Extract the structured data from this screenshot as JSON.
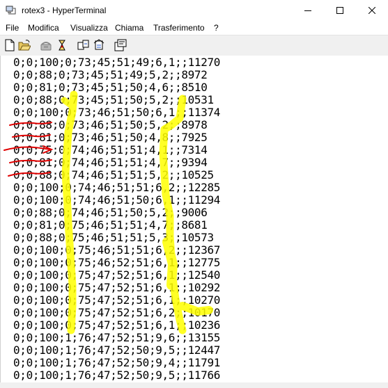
{
  "window": {
    "title": "rotex3 - HyperTerminal",
    "icons": [
      "hyperterminal-app-icon",
      "minimize-icon",
      "maximize-icon",
      "close-icon"
    ]
  },
  "menu": {
    "items": [
      "File",
      "Modifica",
      "Visualizza",
      "Chiama",
      "Trasferimento",
      "?"
    ]
  },
  "toolbar": {
    "icons": [
      "new-document-icon",
      "open-folder-icon",
      "call-icon",
      "disconnect-icon",
      "send-file-icon",
      "receive-file-icon",
      "properties-icon"
    ]
  },
  "terminal": {
    "lines": [
      "0;0;100;0;73;45;51;49;6,1;;11270",
      "0;0;88;0;73;45;51;49;5,2;;8972",
      "0;0;81;0;73;45;51;50;4,6;;8510",
      "0;0;88;0;73;45;51;50;5,2;;10531",
      "0;0;100;0;73;46;51;50;6,1;;11374",
      "0;0;88;0;73;46;51;50;5,2;;8978",
      "0;0;81;0;73;46;51;50;4,8;;7925",
      "0;0;75;0;74;46;51;51;4,1;;7314",
      "0;0;81;0;74;46;51;51;4,7;;9394",
      "0;0;88;0;74;46;51;51;5,2;;10525",
      "0;0;100;0;74;46;51;51;6,2;;12285",
      "0;0;100;0;74;46;51;50;6,1;;11294",
      "0;0;88;0;74;46;51;50;5,2;;9006",
      "0;0;81;0;75;46;51;51;4,7;;8681",
      "0;0;88;0;75;46;51;51;5,3;;10573",
      "0;0;100;0;75;46;51;51;6,2;;12367",
      "0;0;100;0;75;46;52;51;6,1;;12775",
      "0;0;100;0;75;47;52;51;6,1;;12540",
      "0;0;100;0;75;47;52;51;6,1;;10292",
      "0;0;100;0;75;47;52;51;6,1;;10270",
      "0;0;100;0;75;47;52;51;6,2;;10170",
      "0;0;100;0;75;47;52;51;6,1;;10236",
      "0;0;100;1;76;47;52;51;9,6;;13155",
      "0;0;100;1;76;47;52;50;9,5;;12447",
      "0;0;100;1;76;47;52;50;9,4;;11791",
      "0;0;100;1;76;47;52;50;9,5;;11766"
    ]
  },
  "annotations": {
    "highlight_color": "#ffff00",
    "strike_color": "#e00000",
    "struck_line_indices": [
      5,
      6,
      7,
      8,
      9
    ],
    "arrow_line_index": 7
  }
}
